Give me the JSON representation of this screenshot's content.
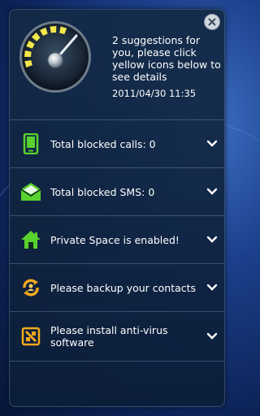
{
  "header": {
    "message": "2 suggestions for you, please click yellow icons below to see details",
    "timestamp": "2011/04/30 11:35"
  },
  "items": [
    {
      "label": "Total blocked calls: 0",
      "icon": "phone-icon",
      "color": "#59d12f"
    },
    {
      "label": "Total blocked SMS: 0",
      "icon": "envelope-icon",
      "color": "#59d12f"
    },
    {
      "label": "Private Space is enabled!",
      "icon": "house-icon",
      "color": "#59d12f"
    },
    {
      "label": "Please backup your contacts",
      "icon": "backup-icon",
      "color": "#f2a81d"
    },
    {
      "label": "Please install anti-virus software",
      "icon": "antivirus-icon",
      "color": "#f2a81d"
    }
  ],
  "colors": {
    "ok": "#59d12f",
    "warning": "#f2a81d",
    "gauge_segments": "#f3e84a"
  }
}
